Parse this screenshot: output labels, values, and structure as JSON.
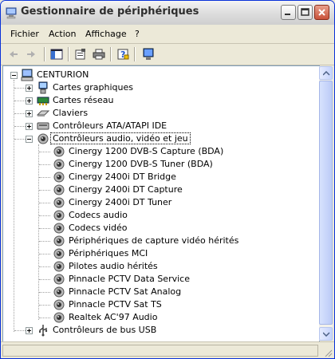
{
  "window": {
    "title": "Gestionnaire de périphériques"
  },
  "menu": [
    "Fichier",
    "Action",
    "Affichage",
    "?"
  ],
  "toolbar": [
    {
      "name": "back-icon"
    },
    {
      "name": "forward-icon"
    },
    {
      "name": "console-tree-icon"
    },
    {
      "name": "properties-icon"
    },
    {
      "name": "print-icon"
    },
    {
      "name": "help-icon"
    },
    {
      "name": "display-icon"
    }
  ],
  "tree": {
    "root": "CENTURION",
    "categories": [
      {
        "label": "Cartes graphiques",
        "icon": "display-adapter-icon",
        "expanded": false
      },
      {
        "label": "Cartes réseau",
        "icon": "network-adapter-icon",
        "expanded": false
      },
      {
        "label": "Claviers",
        "icon": "keyboard-icon",
        "expanded": false
      },
      {
        "label": "Contrôleurs ATA/ATAPI IDE",
        "icon": "ide-controller-icon",
        "expanded": false
      },
      {
        "label": "Contrôleurs audio, vidéo et jeu",
        "icon": "speaker-icon",
        "expanded": true,
        "selected": true,
        "children": [
          "Cinergy 1200 DVB-S Capture (BDA)",
          "Cinergy 1200 DVB-S Tuner (BDA)",
          "Cinergy 2400i DT Bridge",
          "Cinergy 2400i DT Capture",
          "Cinergy 2400i DT Tuner",
          "Codecs audio",
          "Codecs vidéo",
          "Périphériques de capture vidéo hérités",
          "Périphériques MCI",
          "Pilotes audio hérités",
          "Pinnacle PCTV Data Service",
          "Pinnacle PCTV Sat Analog",
          "Pinnacle PCTV Sat TS",
          "Realtek AC'97 Audio"
        ]
      },
      {
        "label": "Contrôleurs de bus USB",
        "icon": "usb-icon",
        "expanded": false
      }
    ]
  }
}
